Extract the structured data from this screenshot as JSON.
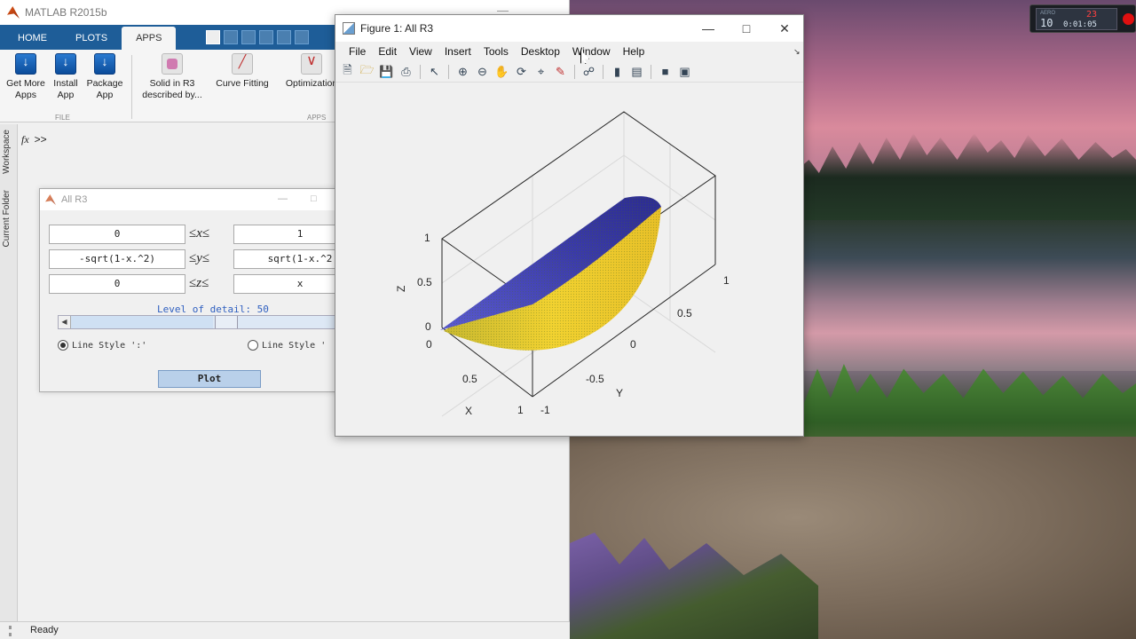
{
  "matlab": {
    "title": "MATLAB R2015b",
    "tabs": [
      {
        "label": "HOME"
      },
      {
        "label": "PLOTS"
      },
      {
        "label": "APPS"
      }
    ],
    "ribbon": {
      "get_more_apps": "Get More\nApps",
      "install_app": "Install\nApp",
      "package_app": "Package\nApp",
      "file_group": "FILE",
      "apps_group": "APPS",
      "app_solid": "Solid in R3\ndescribed by...",
      "app_curve": "Curve Fitting",
      "app_opt": "Optimization"
    },
    "side_tabs": {
      "workspace": "Workspace",
      "current_folder": "Current Folder"
    },
    "command_prompt": ">>",
    "fx": "fx",
    "status": "Ready"
  },
  "allr3": {
    "title": "All R3",
    "x_lower": "0",
    "x_upper": "1",
    "y_lower": "-sqrt(1-x.^2)",
    "y_upper": "sqrt(1-x.^2",
    "z_lower": "0",
    "z_upper": "x",
    "rel_x_1": "≤",
    "rel_x_var": "x",
    "rel_x_2": "≤",
    "rel_y_1": "≤",
    "rel_y_var": "y",
    "rel_y_2": "≤",
    "rel_z_1": "≤",
    "rel_z_var": "z",
    "rel_z_2": "≤",
    "detail_label": "Level of detail: 50",
    "detail_value": 50,
    "radio1": "Line Style ':'",
    "radio2": "Line Style '",
    "plot_button": "Plot"
  },
  "figure": {
    "title": "Figure 1: All R3",
    "menu": [
      "File",
      "Edit",
      "View",
      "Insert",
      "Tools",
      "Desktop",
      "Window",
      "Help"
    ],
    "toolbar_icons": [
      "new-file-icon",
      "open-icon",
      "save-icon",
      "print-icon",
      "arrow-icon",
      "zoom-in-icon",
      "zoom-out-icon",
      "pan-icon",
      "rotate-icon",
      "data-cursor-icon",
      "brush-icon",
      "link-icon",
      "colorbar-icon",
      "legend-icon",
      "hide-tools-icon",
      "show-tools-icon"
    ]
  },
  "plot3d": {
    "zlabel": "Z",
    "xlabel": "X",
    "ylabel": "Y",
    "z_ticks": [
      "1",
      "0.5",
      "0"
    ],
    "x_ticks": [
      "0",
      "0.5",
      "1"
    ],
    "y_ticks": [
      "-1",
      "-0.5",
      "0",
      "0.5",
      "1"
    ],
    "colors": {
      "top_surface": "#3c3ca8",
      "side_surface": "#e8c830",
      "axes": "#262626",
      "grid": "#d8d8d8"
    }
  },
  "gadget": {
    "label": "AERO",
    "left_value": "10",
    "top_value": "23",
    "time": "0:01:05"
  }
}
